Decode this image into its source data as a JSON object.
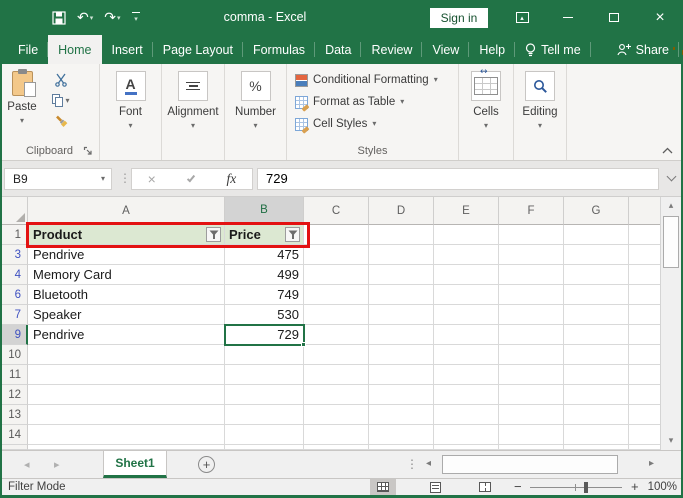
{
  "title_bar": {
    "title": "comma - Excel",
    "sign_in": "Sign in"
  },
  "ribbon_tabs": {
    "file": "File",
    "home": "Home",
    "insert": "Insert",
    "page_layout": "Page Layout",
    "formulas": "Formulas",
    "data": "Data",
    "review": "Review",
    "view": "View",
    "help": "Help",
    "tell_me": "Tell me",
    "share": "Share"
  },
  "ribbon": {
    "clipboard": {
      "paste": "Paste",
      "group_label": "Clipboard"
    },
    "font": {
      "icon_letter": "A",
      "label": "Font"
    },
    "alignment": {
      "label": "Alignment"
    },
    "number": {
      "icon_symbol": "%",
      "label": "Number"
    },
    "styles": {
      "conditional_formatting": "Conditional Formatting",
      "format_as_table": "Format as Table",
      "cell_styles": "Cell Styles",
      "group_label": "Styles"
    },
    "cells": {
      "label": "Cells"
    },
    "editing": {
      "label": "Editing"
    }
  },
  "formula_bar": {
    "name_box": "B9",
    "fx_label": "fx",
    "value": "729"
  },
  "sheet": {
    "column_headers": [
      "A",
      "B",
      "C",
      "D",
      "E",
      "F",
      "G"
    ],
    "selected_column": "B",
    "selected_cell": "B9",
    "filter_header": {
      "product": "Product",
      "price": "Price"
    },
    "rows": [
      {
        "num": "3",
        "product": "Pendrive",
        "price": "475"
      },
      {
        "num": "4",
        "product": "Memory Card",
        "price": "499"
      },
      {
        "num": "6",
        "product": "Bluetooth",
        "price": "749"
      },
      {
        "num": "7",
        "product": "Speaker",
        "price": "530"
      },
      {
        "num": "9",
        "product": "Pendrive",
        "price": "729"
      }
    ],
    "empty_row_numbers": [
      "10",
      "11",
      "12",
      "13",
      "14"
    ]
  },
  "sheet_tabs": {
    "active_tab": "Sheet1"
  },
  "status_bar": {
    "mode": "Filter Mode",
    "zoom_level": "100%"
  },
  "colors": {
    "excel_green": "#217346",
    "table_header_green": "#dce8d2",
    "annotation_red": "#e31212",
    "filtered_row_number_blue": "#3f51c1",
    "selection_green": "#217346"
  }
}
